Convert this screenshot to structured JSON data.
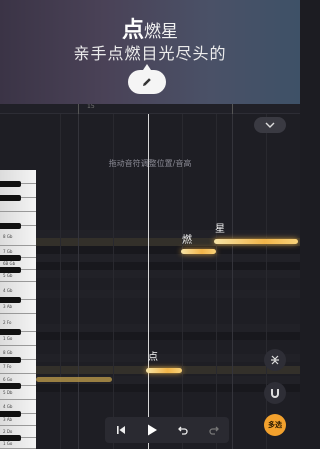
{
  "header": {
    "title_highlight": "点",
    "title_rest": "燃星",
    "subtitle": "亲手点燃目光尽头的"
  },
  "ruler": {
    "marker": "15"
  },
  "editor": {
    "hint": "拖动音符调整位置/音高"
  },
  "piano_keys": [
    "8 Gb",
    "7 Gb",
    "6B Gb",
    "5 Gb",
    "4 Gb",
    "3 Ab",
    "2 Fo",
    "1 Go",
    "8 Gb",
    "7 Fo",
    "6 Go",
    "5 Db",
    "4 Gb",
    "3 Ab",
    "2 Do",
    "1 Go"
  ],
  "lyrics": {
    "note1": "点",
    "note2": "燃",
    "note3": "星"
  },
  "buttons": {
    "multi_select": "多选"
  },
  "colors": {
    "accent": "#f2a12d",
    "note_glow": "#f2b54a"
  }
}
